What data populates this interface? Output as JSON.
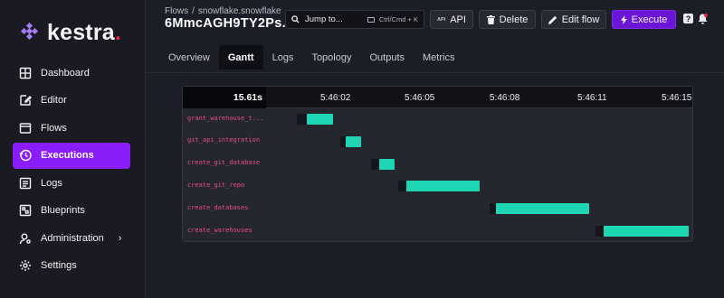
{
  "app": {
    "logo_text": "kestra",
    "logo_dot": "."
  },
  "sidebar": {
    "items": [
      {
        "label": "Dashboard",
        "icon": "dashboard-icon",
        "active": false
      },
      {
        "label": "Editor",
        "icon": "editor-icon",
        "active": false
      },
      {
        "label": "Flows",
        "icon": "flows-icon",
        "active": false
      },
      {
        "label": "Executions",
        "icon": "executions-icon",
        "active": true
      },
      {
        "label": "Logs",
        "icon": "logs-icon",
        "active": false
      },
      {
        "label": "Blueprints",
        "icon": "blueprints-icon",
        "active": false
      },
      {
        "label": "Administration",
        "icon": "administration-icon",
        "active": false,
        "has_chevron": true
      },
      {
        "label": "Settings",
        "icon": "settings-icon",
        "active": false
      }
    ]
  },
  "header": {
    "breadcrumb": [
      "Flows",
      "/",
      "snowflake.snowflake"
    ],
    "title": "6MmcAGH9TY2Ps...",
    "jump_label": "Jump to...",
    "jump_shortcut": "Ctrl/Cmd + K",
    "api_tiny": "API",
    "api_label": "API",
    "delete_label": "Delete",
    "edit_label": "Edit flow",
    "execute_label": "Execute",
    "help_label": "?"
  },
  "tabs": [
    {
      "label": "Overview",
      "active": false
    },
    {
      "label": "Gantt",
      "active": true
    },
    {
      "label": "Logs",
      "active": false
    },
    {
      "label": "Topology",
      "active": false
    },
    {
      "label": "Outputs",
      "active": false
    },
    {
      "label": "Metrics",
      "active": false
    }
  ],
  "gantt": {
    "duration": "15.61s",
    "ticks": [
      "5:46:02",
      "5:46:05",
      "5:46:08",
      "5:46:11",
      "5:46:15"
    ],
    "colors": {
      "bar": "#1fd6b4",
      "task_name": "#e84b8a"
    },
    "tasks": [
      {
        "name": "grant_warehouse_t..."
      },
      {
        "name": "git_api_integration"
      },
      {
        "name": "create_git_database"
      },
      {
        "name": "create_git_repo"
      },
      {
        "name": "create_databases"
      },
      {
        "name": "create_warehouses"
      }
    ]
  }
}
